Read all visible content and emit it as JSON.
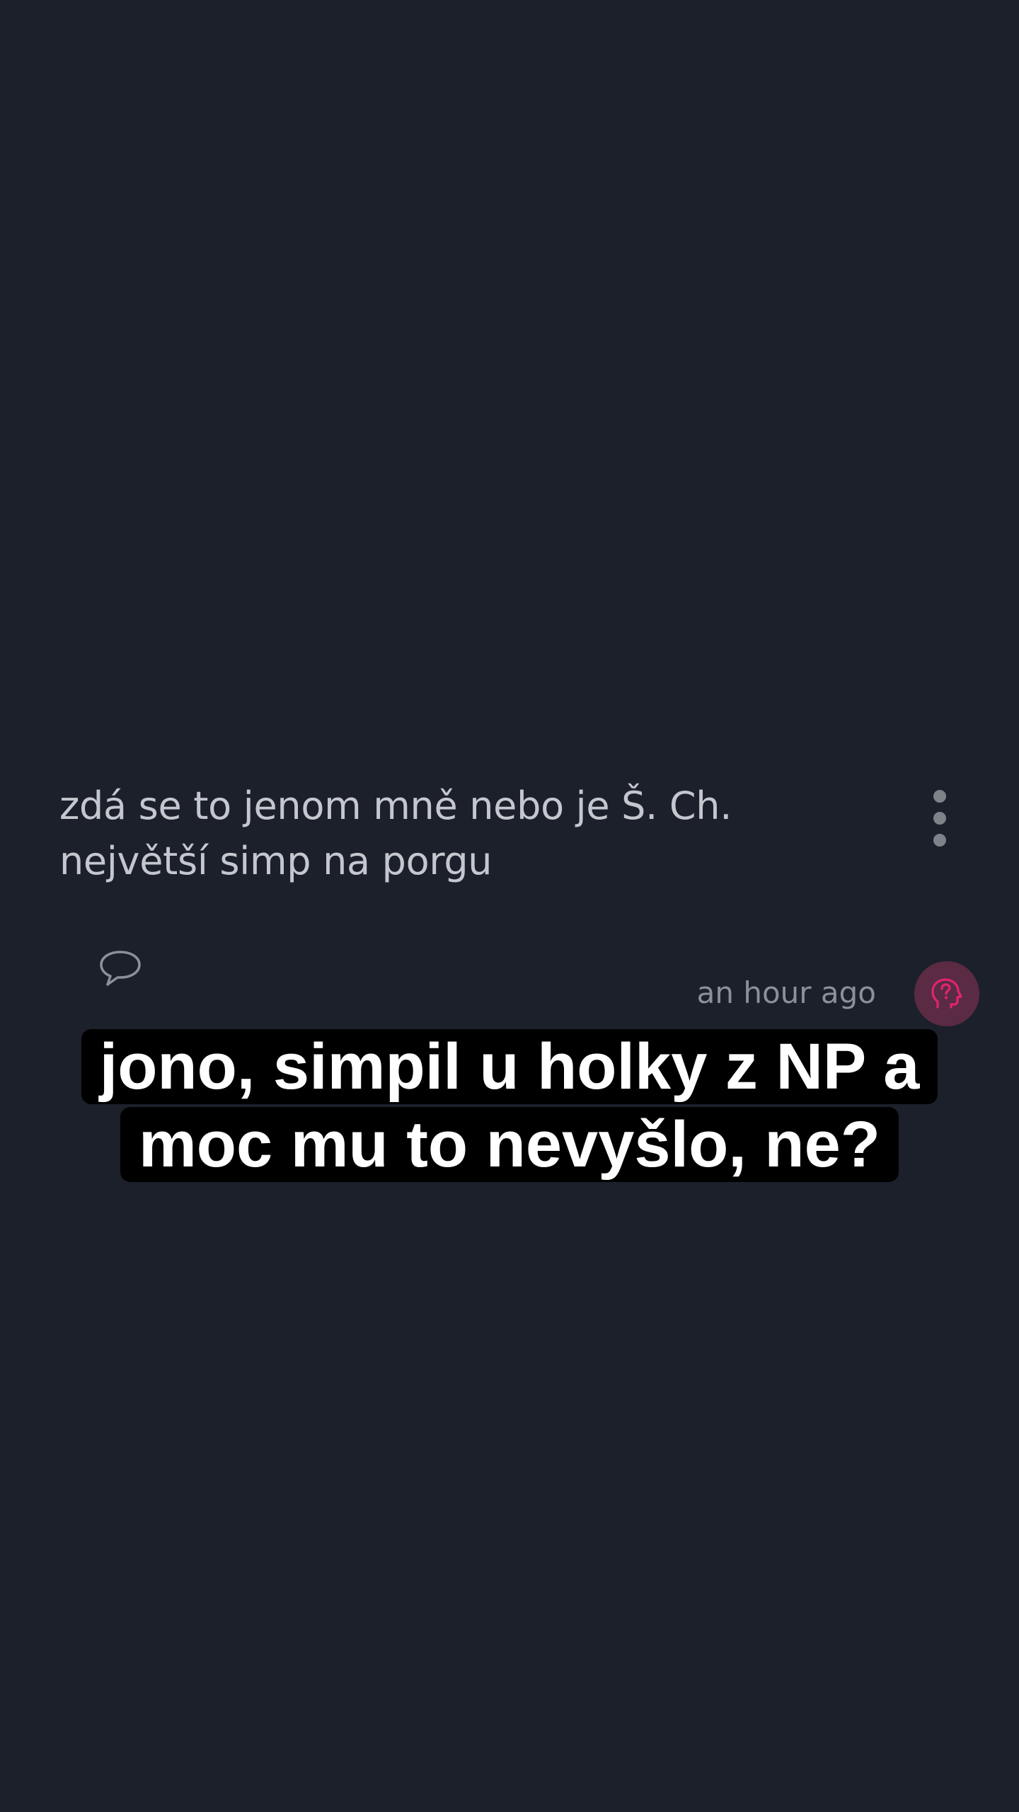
{
  "post": {
    "text": "zdá se to jenom mně nebo je Š. Ch. největší simp na porgu",
    "timestamp": "an hour ago",
    "icons": {
      "more": "more-vertical-icon",
      "comment": "comment-bubble-icon",
      "avatar": "anonymous-head-question-icon"
    }
  },
  "caption": {
    "line1": "jono, simpil u holky z NP a",
    "line2": "moc mu to nevyšlo, ne?"
  },
  "colors": {
    "background": "#1b202b",
    "text": "#c4c7cd",
    "muted": "#8c9097",
    "accent": "#e0246f",
    "avatar_bg": "#5a2b43",
    "caption_bg": "#000000",
    "caption_text": "#ffffff"
  }
}
